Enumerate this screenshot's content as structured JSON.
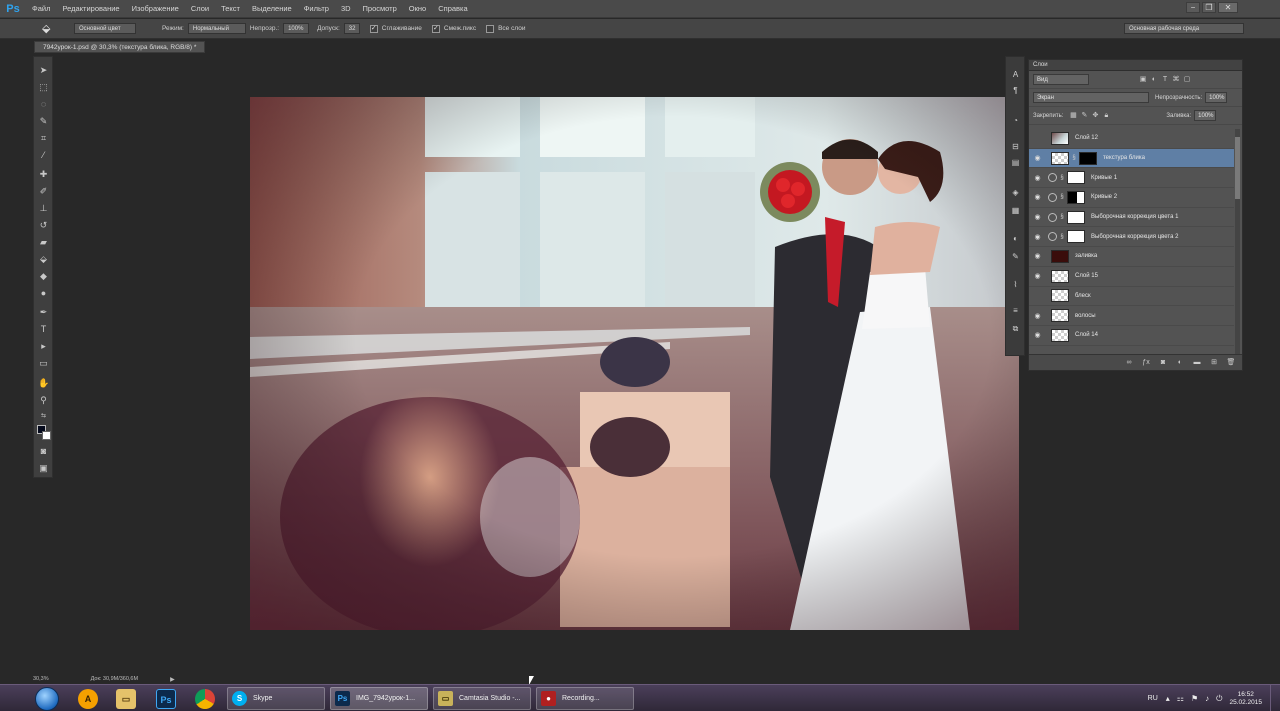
{
  "menubar": {
    "logo": "Ps",
    "items": [
      "Файл",
      "Редактирование",
      "Изображение",
      "Слои",
      "Текст",
      "Выделение",
      "Фильтр",
      "3D",
      "Просмотр",
      "Окно",
      "Справка"
    ]
  },
  "options": {
    "source_value": "Основной цвет",
    "mode_label": "Режим:",
    "mode_value": "Нормальный",
    "opacity_label": "Непрозр.:",
    "opacity_value": "100%",
    "tolerance_label": "Допуск:",
    "tolerance_value": "32",
    "antialias_label": "Сглаживание",
    "contiguous_label": "Смеж.пикс",
    "all_layers_label": "Все слои",
    "workspace_value": "Основная рабочая среда"
  },
  "document": {
    "tab_title": "7942урок-1.psd @ 30,3% (текстура блика, RGB/8) *",
    "zoom": "30,3%",
    "doc_size": "Док: 30,9М/360,6М"
  },
  "layers_panel": {
    "title": "Слои",
    "kind_value": "Вид",
    "blend_mode": "Экран",
    "opacity_label": "Непрозрачность:",
    "opacity_value": "100%",
    "lock_label": "Закрепить:",
    "fill_label": "Заливка:",
    "fill_value": "100%",
    "layers": [
      {
        "name": "Слой 12",
        "visible": false,
        "selected": false
      },
      {
        "name": "текстура блика",
        "visible": true,
        "selected": true
      },
      {
        "name": "Кривые 1",
        "visible": true,
        "selected": false
      },
      {
        "name": "Кривые 2",
        "visible": true,
        "selected": false
      },
      {
        "name": "Выборочная коррекция цвета 1",
        "visible": true,
        "selected": false
      },
      {
        "name": "Выборочная коррекция цвета 2",
        "visible": true,
        "selected": false
      },
      {
        "name": "заливка",
        "visible": true,
        "selected": false
      },
      {
        "name": "Слой 15",
        "visible": true,
        "selected": false
      },
      {
        "name": "блеск",
        "visible": false,
        "selected": false
      },
      {
        "name": "волосы",
        "visible": true,
        "selected": false
      },
      {
        "name": "Слой 14",
        "visible": true,
        "selected": false
      }
    ]
  },
  "taskbar": {
    "buttons": [
      "Skype",
      "IMG_7942урок-1...",
      "Camtasia Studio -...",
      "Recording..."
    ],
    "language": "RU",
    "time": "16:52",
    "date": "25.02.2015"
  },
  "colors": {
    "foreground": "#050a1c",
    "background": "#ffffff",
    "selected_layer": "#5f7fa5"
  }
}
